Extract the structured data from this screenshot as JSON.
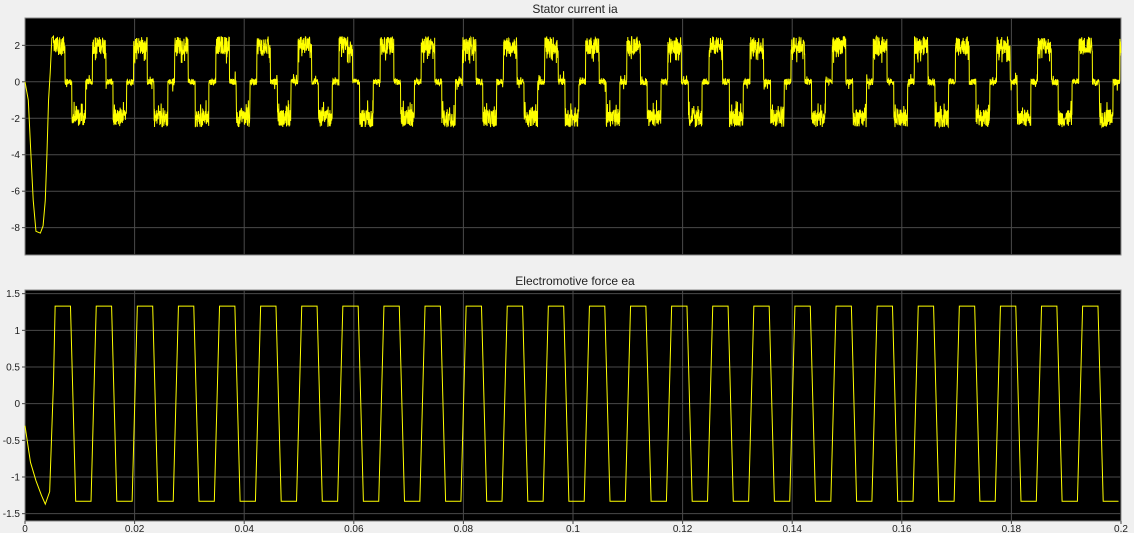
{
  "chart_data": [
    {
      "type": "line",
      "title": "Stator current ia",
      "xlabel": "",
      "ylabel": "",
      "xlim": [
        0,
        0.2
      ],
      "ylim": [
        -9.5,
        3.5
      ],
      "yticks": [
        2,
        0,
        -2,
        -4,
        -6,
        -8
      ],
      "grid": true,
      "background": "#000000",
      "trace_color": "#ffff00",
      "waveform": {
        "description": "six-step quasi-square current, chopped (PWM ripple)",
        "period": 0.0075,
        "amplitude": 2.0,
        "ripple": 0.35,
        "startup": [
          {
            "x": 0.0,
            "y": 0.0
          },
          {
            "x": 0.0006,
            "y": -1.0
          },
          {
            "x": 0.001,
            "y": -3.5
          },
          {
            "x": 0.0015,
            "y": -6.5
          },
          {
            "x": 0.002,
            "y": -8.2
          },
          {
            "x": 0.0028,
            "y": -8.3
          },
          {
            "x": 0.0033,
            "y": -7.9
          },
          {
            "x": 0.0037,
            "y": -6.5
          },
          {
            "x": 0.004,
            "y": -4.0
          },
          {
            "x": 0.0043,
            "y": -1.0
          },
          {
            "x": 0.0046,
            "y": 0.5
          },
          {
            "x": 0.0049,
            "y": 2.4
          },
          {
            "x": 0.0052,
            "y": 2.5
          }
        ]
      }
    },
    {
      "type": "line",
      "title": "Electromotive force ea",
      "xlabel": "",
      "ylabel": "",
      "xlim": [
        0,
        0.2
      ],
      "ylim": [
        -1.6,
        1.55
      ],
      "yticks": [
        1.5,
        1,
        0.5,
        0,
        -0.5,
        -1,
        -1.5
      ],
      "xticks": [
        0,
        0.02,
        0.04,
        0.06,
        0.08,
        0.1,
        0.12,
        0.14,
        0.16,
        0.18,
        0.2
      ],
      "grid": true,
      "background": "#000000",
      "trace_color": "#ffff00",
      "waveform": {
        "description": "trapezoidal back-EMF",
        "period": 0.0075,
        "amplitude": 1.33,
        "phase_start": 0.0055,
        "startup": [
          {
            "x": 0.0,
            "y": -0.3
          },
          {
            "x": 0.001,
            "y": -0.8
          },
          {
            "x": 0.002,
            "y": -1.05
          },
          {
            "x": 0.003,
            "y": -1.25
          },
          {
            "x": 0.0037,
            "y": -1.37
          }
        ]
      }
    }
  ]
}
